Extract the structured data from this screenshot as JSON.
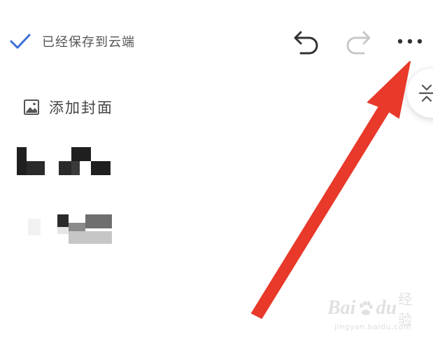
{
  "toolbar": {
    "save_status": "已经保存到云端",
    "undo_icon": "undo-icon",
    "redo_icon": "redo-icon",
    "more_icon": "more-horizontal-icon",
    "check_icon": "checkmark-icon"
  },
  "editor": {
    "add_cover_label": "添加封面",
    "add_cover_icon": "image-icon",
    "side_handle_icon": "expand-collapse-icon"
  },
  "annotation": {
    "arrow_color": "#e8392a",
    "points_to": "more-button"
  },
  "watermark": {
    "brand": "Bai",
    "brand_tail": "du",
    "cn": "经验",
    "url": "jingyan.baidu.com"
  },
  "colors": {
    "accent_check": "#3a6fd8",
    "text_primary": "#444444",
    "text_status": "#555555",
    "icon_enabled": "#333333",
    "icon_disabled": "#c8c8c8",
    "arrow": "#e8392a"
  }
}
